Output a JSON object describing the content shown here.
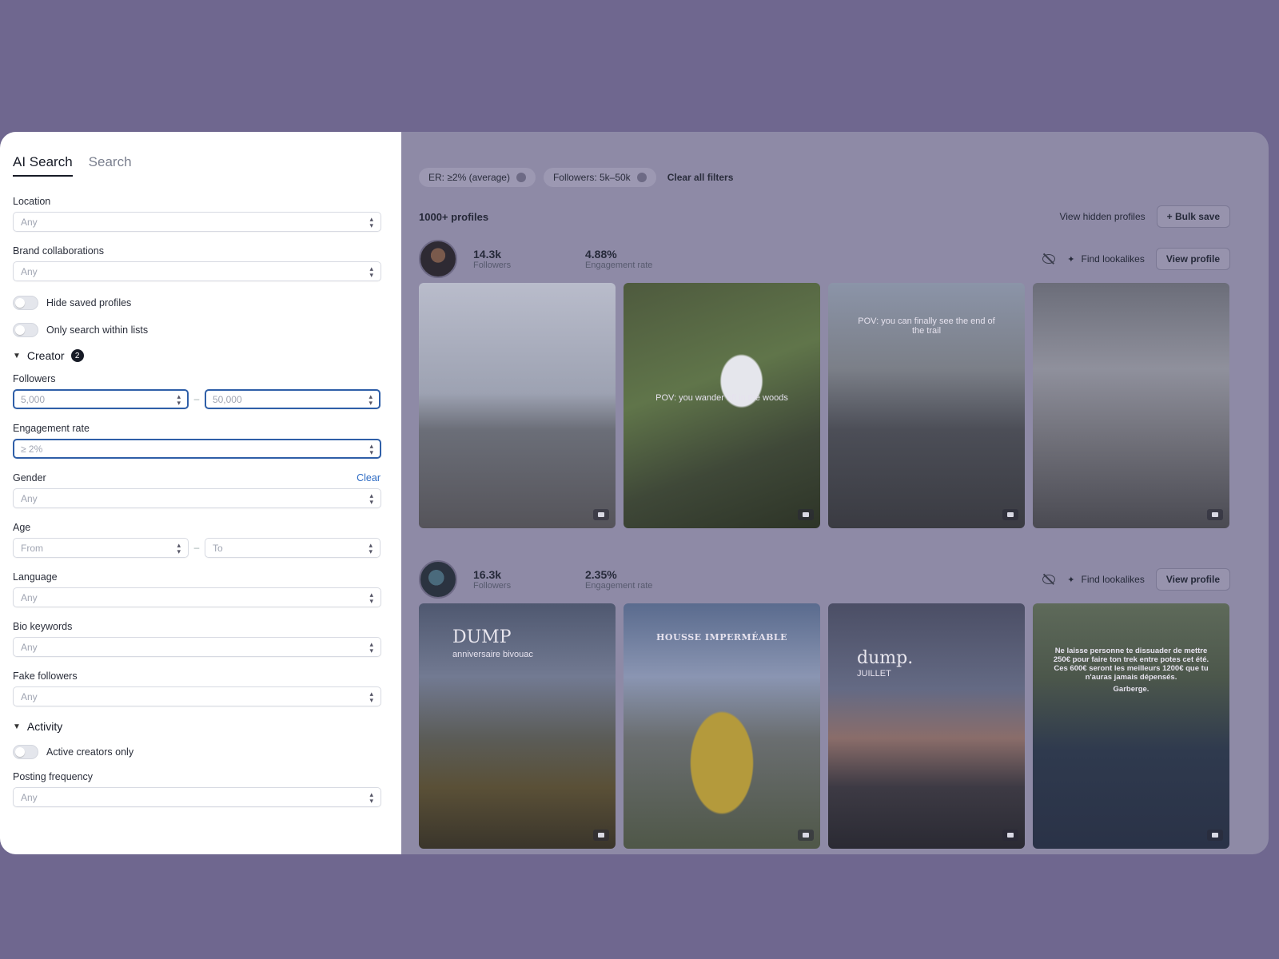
{
  "tabs": [
    "AI Search",
    "Search"
  ],
  "filters_panel": {
    "location": {
      "label": "Location",
      "value": "Any"
    },
    "brand": {
      "label": "Brand collaborations",
      "value": "Any"
    },
    "toggles": [
      "Hide saved profiles",
      "Only search within lists"
    ],
    "creator": {
      "title": "Creator",
      "count": "2"
    },
    "followers": {
      "label": "Followers",
      "min": "5,000",
      "max": "50,000"
    },
    "engagement": {
      "label": "Engagement rate",
      "value": "≥ 2%"
    },
    "gender": {
      "label": "Gender",
      "clear": "Clear",
      "value": "Any"
    },
    "age": {
      "label": "Age",
      "from": "From",
      "to": "To"
    },
    "language": {
      "label": "Language",
      "value": "Any"
    },
    "bio": {
      "label": "Bio keywords",
      "value": "Any"
    },
    "fake": {
      "label": "Fake followers",
      "value": "Any"
    },
    "activity": {
      "title": "Activity",
      "toggle": "Active creators only"
    },
    "posting": {
      "label": "Posting frequency",
      "value": "Any"
    }
  },
  "main": {
    "chips": [
      "ER: ≥2% (average)",
      "Followers: 5k–50k"
    ],
    "clear_all": "Clear all filters",
    "results_count": "1000+ profiles",
    "view_hidden": "View hidden profiles",
    "bulk_save": "+ Bulk save",
    "find_lookalikes": "Find lookalikes",
    "view_profile": "View profile",
    "profiles": [
      {
        "followers": "14.3k",
        "followers_label": "Followers",
        "er": "4.88%",
        "er_label": "Engagement rate",
        "overlays": [
          "",
          "POV: you wander off in the woods",
          "POV: you can finally see the end of the trail",
          ""
        ]
      },
      {
        "followers": "16.3k",
        "followers_label": "Followers",
        "er": "2.35%",
        "er_label": "Engagement rate",
        "overlays": [
          "DUMP",
          "HOUSSE IMPERMÉABLE",
          "dump.",
          "Ne laisse personne te dissuader de mettre 250€ pour faire ton trek entre potes cet été. Ces 600€ seront les meilleurs 1200€ que tu n'auras jamais dépensés."
        ],
        "overlay_sub": [
          "anniversaire bivouac",
          "",
          "JUILLET",
          "Garberge."
        ]
      }
    ]
  },
  "colors": {
    "backdrop": "#6f678f",
    "accent": "#2f5fa8",
    "link": "#2d6bc4"
  },
  "icons": [
    "chevron-down-icon",
    "select-arrows-icon",
    "close-icon",
    "eye-off-icon",
    "sparkle-icon",
    "video-icon"
  ]
}
